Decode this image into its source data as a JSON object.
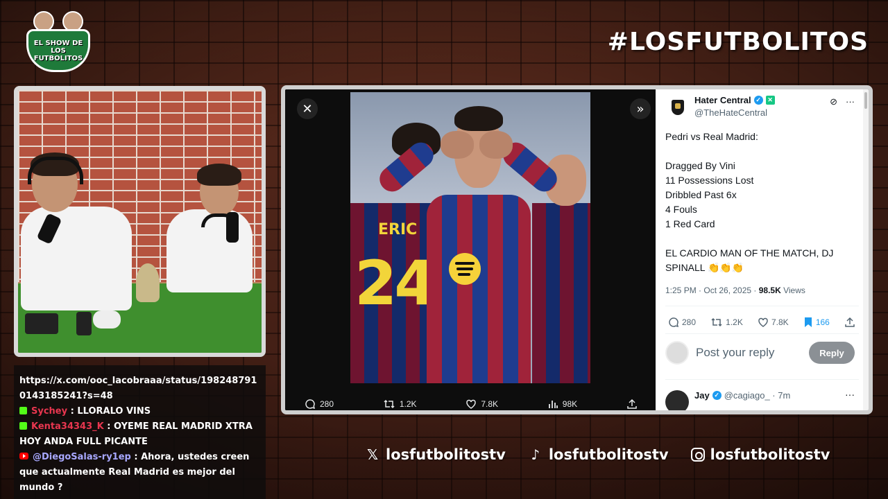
{
  "overlay": {
    "logo_lines": [
      "EL SHOW DE LOS",
      "FUTBOLITOS"
    ],
    "hashtag": "#LOSFUTBOLITOS",
    "socials": [
      {
        "icon": "x-icon",
        "handle": "losfutbolitostv"
      },
      {
        "icon": "tiktok-icon",
        "handle": "losfutbolitostv"
      },
      {
        "icon": "instagram-icon",
        "handle": "losfutbolitostv"
      }
    ]
  },
  "chat": {
    "messages": [
      {
        "platform": "",
        "user": "",
        "text": "https://x.com/ooc_lacobraaa/status/1982487910143185241?s=48"
      },
      {
        "platform": "kick",
        "user": "Sychey",
        "text": ": LLORALO VINS"
      },
      {
        "platform": "kick",
        "user": "Kenta34343_K",
        "text": ": OYEME REAL MADRID XTRA HOY ANDA FULL PICANTE"
      },
      {
        "platform": "youtube",
        "user": "@DiegoSalas-ry1ep",
        "text": ": Ahora, ustedes creen que actualmente Real Madrid es mejor del mundo ?"
      }
    ]
  },
  "photo": {
    "shirt_name": "ERIC",
    "shirt_number": "24"
  },
  "media_actions": {
    "replies": "280",
    "reposts": "1.2K",
    "likes": "7.8K",
    "views": "98K"
  },
  "tweet": {
    "author_name": "Hater Central",
    "author_handle": "@TheHateCentral",
    "body": "Pedri vs Real Madrid:\n\nDragged By Vini\n11 Possessions Lost\nDribbled Past 6x\n4 Fouls\n1 Red Card\n\nEL CARDIO MAN OF THE MATCH, DJ SPINALL 👏👏👏",
    "time": "1:25 PM · Oct 26, 2025 · ",
    "views_count": "98.5K",
    "views_label": " Views",
    "replies": "280",
    "reposts": "1.2K",
    "likes": "7.8K",
    "bookmarks": "166",
    "reply_placeholder": "Post your reply",
    "reply_button": "Reply",
    "next_reply_name": "Jay",
    "next_reply_handle": "@cagiago_ · 7m"
  },
  "colors": {
    "x_blue": "#1d9bf0",
    "kick_green": "#53fc18",
    "chat_red": "#e8364f"
  }
}
